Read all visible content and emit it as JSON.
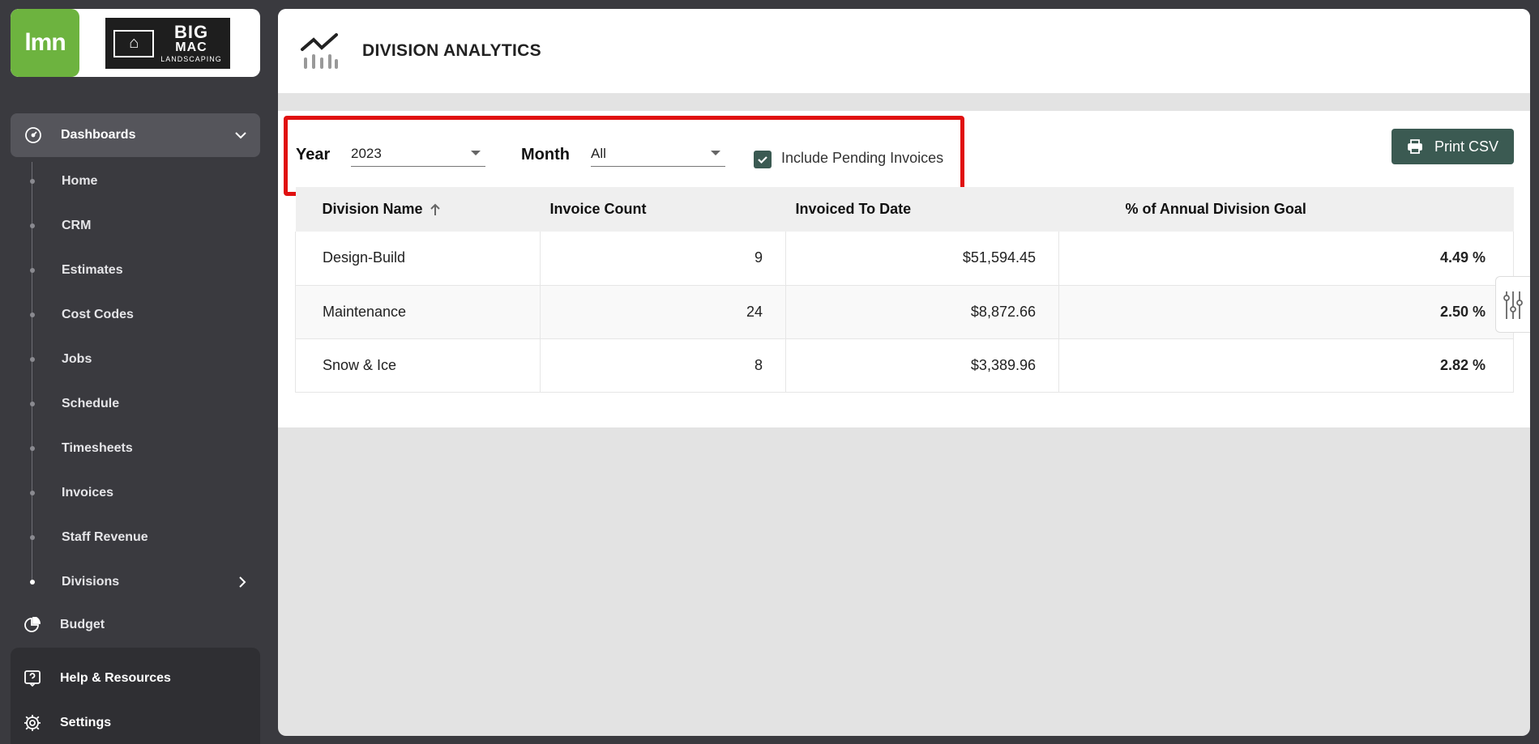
{
  "brand": {
    "lmn_logo": "lmn",
    "company_logo_line1": "BIG",
    "company_logo_line2": "MAC",
    "company_logo_line3": "LANDSCAPING"
  },
  "sidebar": {
    "section": {
      "label": "Dashboards",
      "icon": "gauge-icon"
    },
    "items": [
      {
        "label": "Home"
      },
      {
        "label": "CRM"
      },
      {
        "label": "Estimates"
      },
      {
        "label": "Cost Codes"
      },
      {
        "label": "Jobs"
      },
      {
        "label": "Schedule"
      },
      {
        "label": "Timesheets"
      },
      {
        "label": "Invoices"
      },
      {
        "label": "Staff Revenue"
      },
      {
        "label": "Divisions"
      }
    ],
    "budget_label": "Budget",
    "help_label": "Help & Resources",
    "settings_label": "Settings"
  },
  "header": {
    "title": "DIVISION ANALYTICS",
    "icon": "analytics-chart-icon"
  },
  "filters": {
    "year_label": "Year",
    "year_value": "2023",
    "month_label": "Month",
    "month_value": "All",
    "include_pending_label": "Include Pending Invoices",
    "include_pending_checked": true
  },
  "print_button": {
    "label": "Print CSV",
    "icon": "printer-icon"
  },
  "table": {
    "columns": [
      "Division Name",
      "Invoice Count",
      "Invoiced To Date",
      "% of Annual Division Goal"
    ],
    "rows": [
      {
        "name": "Design-Build",
        "count": "9",
        "invoiced": "$51,594.45",
        "pct": "4.49 %"
      },
      {
        "name": "Maintenance",
        "count": "24",
        "invoiced": "$8,872.66",
        "pct": "2.50 %"
      },
      {
        "name": "Snow & Ice",
        "count": "8",
        "invoiced": "$3,389.96",
        "pct": "2.82 %"
      }
    ]
  },
  "colors": {
    "accent": "#3b5a52",
    "highlight": "#e01010",
    "sidebar_bg": "#3a3a3f",
    "lmn_green": "#6db33f"
  }
}
